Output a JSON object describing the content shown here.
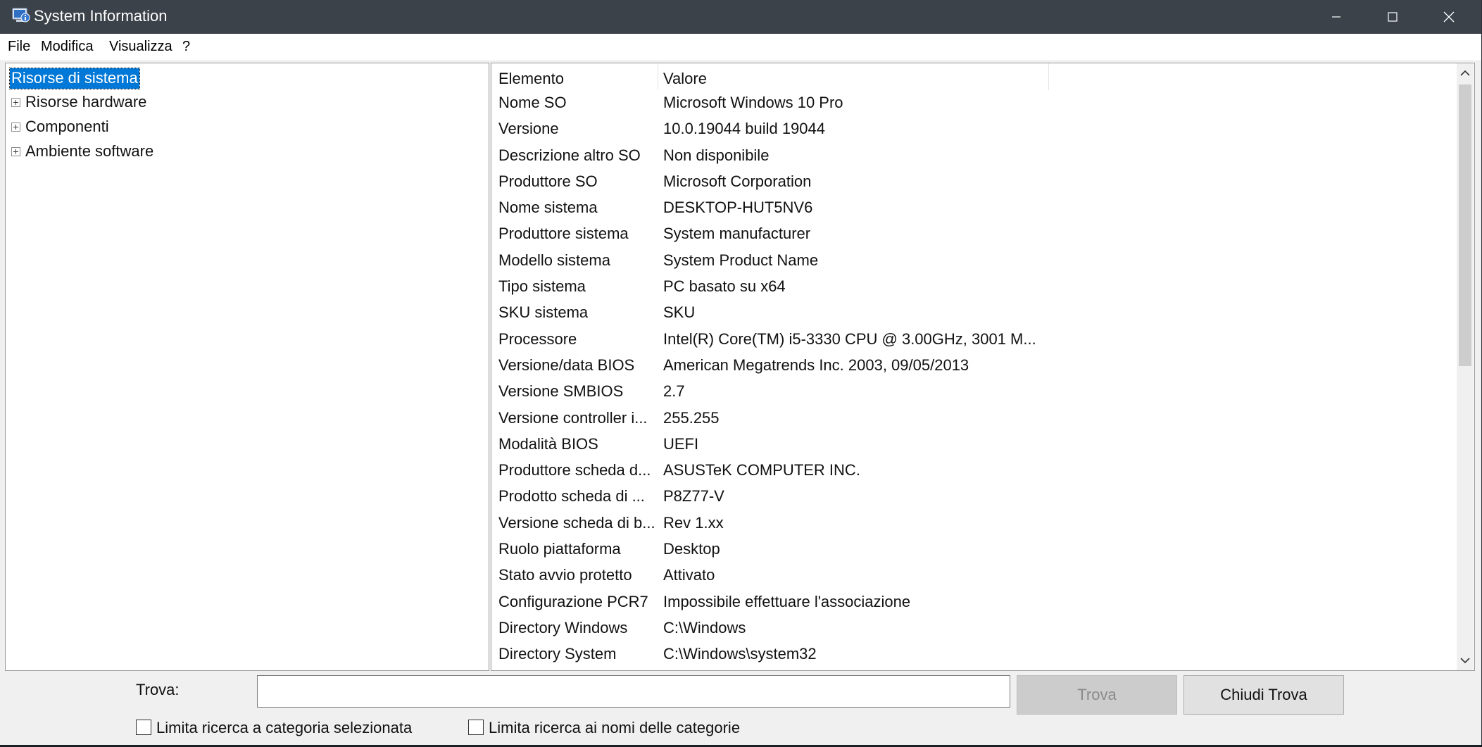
{
  "window": {
    "title": "System Information",
    "app_icon": "system-information-icon",
    "controls": [
      "minimize-icon",
      "maximize-icon",
      "close-icon"
    ]
  },
  "menu": {
    "items": [
      {
        "label": "File"
      },
      {
        "label": "Modifica"
      },
      {
        "label": "Visualizza"
      },
      {
        "label": "?"
      }
    ]
  },
  "tree": {
    "root": "Risorse di sistema",
    "children": [
      {
        "label": "Risorse hardware"
      },
      {
        "label": "Componenti"
      },
      {
        "label": "Ambiente software"
      }
    ]
  },
  "list": {
    "columns": {
      "name": "Elemento",
      "value": "Valore"
    },
    "rows": [
      {
        "name": "Nome SO",
        "value": "Microsoft Windows 10 Pro"
      },
      {
        "name": "Versione",
        "value": "10.0.19044 build 19044"
      },
      {
        "name": "Descrizione altro SO",
        "value": "Non disponibile"
      },
      {
        "name": "Produttore SO",
        "value": "Microsoft Corporation"
      },
      {
        "name": "Nome sistema",
        "value": "DESKTOP-HUT5NV6"
      },
      {
        "name": "Produttore sistema",
        "value": "System manufacturer"
      },
      {
        "name": "Modello sistema",
        "value": "System Product Name"
      },
      {
        "name": "Tipo sistema",
        "value": "PC basato su x64"
      },
      {
        "name": "SKU sistema",
        "value": "SKU"
      },
      {
        "name": "Processore",
        "value": "Intel(R) Core(TM) i5-3330 CPU @ 3.00GHz, 3001 M..."
      },
      {
        "name": "Versione/data BIOS",
        "value": "American Megatrends Inc. 2003, 09/05/2013"
      },
      {
        "name": "Versione SMBIOS",
        "value": "2.7"
      },
      {
        "name": "Versione controller i...",
        "value": "255.255"
      },
      {
        "name": "Modalità BIOS",
        "value": "UEFI"
      },
      {
        "name": "Produttore scheda d...",
        "value": "ASUSTeK COMPUTER INC."
      },
      {
        "name": "Prodotto scheda di ...",
        "value": "P8Z77-V"
      },
      {
        "name": "Versione scheda di b...",
        "value": "Rev 1.xx"
      },
      {
        "name": "Ruolo piattaforma",
        "value": "Desktop"
      },
      {
        "name": "Stato avvio protetto",
        "value": "Attivato"
      },
      {
        "name": "Configurazione PCR7",
        "value": "Impossibile effettuare l'associazione"
      },
      {
        "name": "Directory Windows",
        "value": "C:\\Windows"
      },
      {
        "name": "Directory System",
        "value": "C:\\Windows\\system32"
      }
    ]
  },
  "find": {
    "label": "Trova:",
    "input_value": "",
    "find_button": "Trova",
    "close_button": "Chiudi Trova",
    "limit_category": "Limita ricerca a categoria selezionata",
    "limit_names": "Limita ricerca ai nomi delle categorie"
  },
  "colors": {
    "titlebar": "#3c424a",
    "selection": "#0078d7"
  }
}
